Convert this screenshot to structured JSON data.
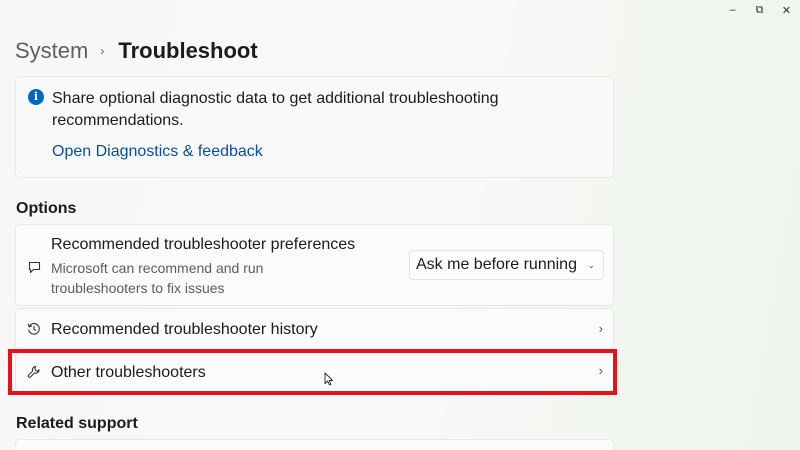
{
  "window_controls": {
    "minimize": "–",
    "maximize": "⧉",
    "close": "✕"
  },
  "breadcrumb": {
    "parent": "System",
    "separator": "›",
    "current": "Troubleshoot"
  },
  "info_banner": {
    "icon": "info-icon",
    "text": "Share optional diagnostic data to get additional troubleshooting recommendations.",
    "link": "Open Diagnostics & feedback"
  },
  "options": {
    "heading": "Options",
    "preferences": {
      "title": "Recommended troubleshooter preferences",
      "description": "Microsoft can recommend and run troubleshooters to fix issues",
      "dropdown_value": "Ask me before running",
      "icon": "chat-icon"
    },
    "history": {
      "title": "Recommended troubleshooter history",
      "icon": "history-icon"
    },
    "other": {
      "title": "Other troubleshooters",
      "icon": "wrench-icon"
    }
  },
  "related": {
    "heading": "Related support"
  },
  "colors": {
    "accent": "#0067c0",
    "link": "#0a4f9c",
    "highlight": "#e8101a"
  }
}
